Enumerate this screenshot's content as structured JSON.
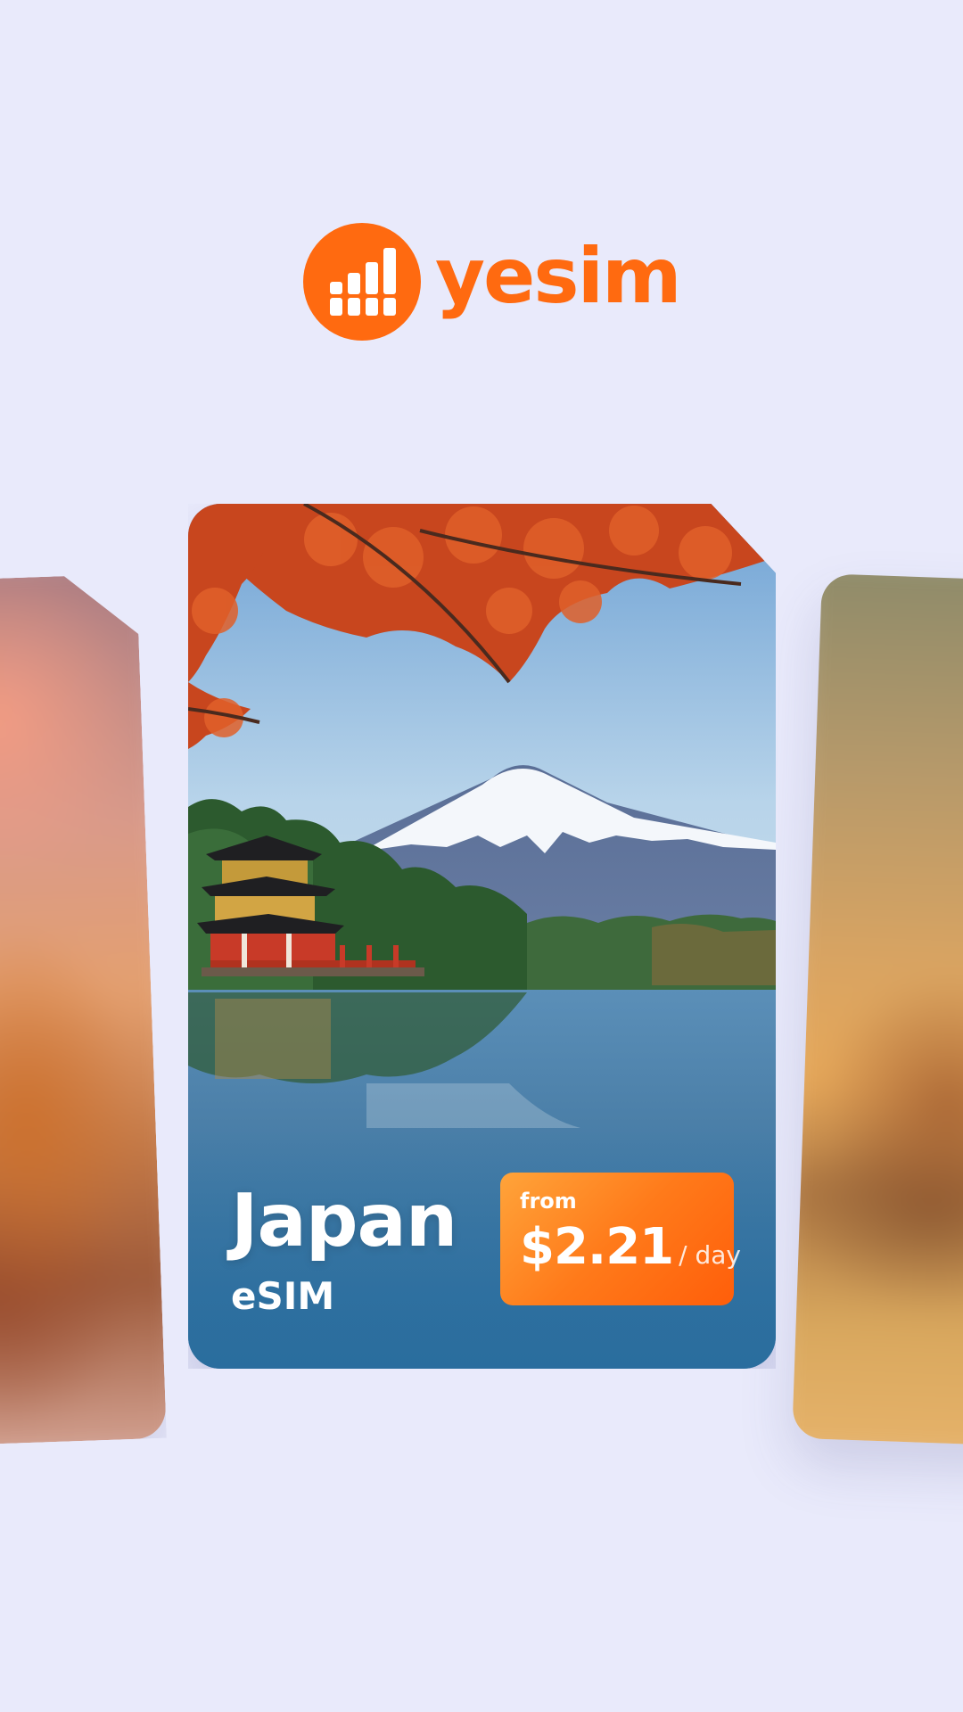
{
  "brand": {
    "name": "yesim",
    "accent_color": "#ff6a10",
    "logo_icon": "signal-bars-icon"
  },
  "carousel": {
    "cards": [
      {
        "position": "left",
        "image": "blurred-sunset-village-photo"
      },
      {
        "position": "center",
        "image": "mount-fuji-pagoda-lake-photo",
        "country": "Japan",
        "product": "eSIM",
        "price": {
          "prefix": "from",
          "amount": "$2.21",
          "unit": "/ day"
        }
      },
      {
        "position": "right",
        "image": "blurred-golden-lake-photo"
      }
    ]
  }
}
